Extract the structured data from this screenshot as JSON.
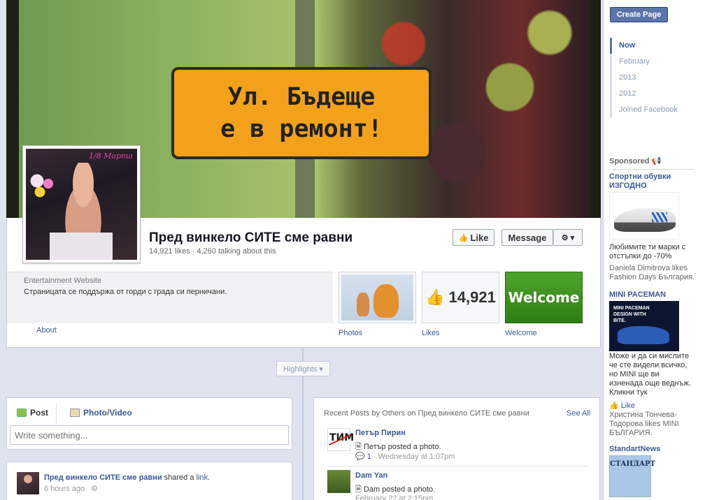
{
  "cover": {
    "sign_line1": "Ул. Бъдеще",
    "sign_line2": "е в ремонт!"
  },
  "profile": {
    "signature": "1/8 Марта"
  },
  "page": {
    "name": "Пред винкело СИТЕ сме равни",
    "stats": "14,921 likes · 4,260 talking about this",
    "category": "Entertainment Website",
    "description": "Страницата се поддържа от горди с града си перничани.",
    "about_label": "About"
  },
  "actions": {
    "like_label": "Like",
    "message_label": "Message",
    "gear_label": "⚙ ▾"
  },
  "apps": {
    "photos_label": "Photos",
    "likes_label": "Likes",
    "likes_count": "14,921",
    "welcome_label": "Welcome",
    "welcome_tile": "Welcome"
  },
  "timeline": {
    "highlights_label": "Highlights ▾"
  },
  "composer": {
    "post_tab": "Post",
    "photo_tab": "Photo",
    "photo_sep": " / ",
    "video_tab": "Video",
    "placeholder": "Write something..."
  },
  "story": {
    "author": "Пред винкело СИТЕ сме равни",
    "verb": " shared a ",
    "object": "link",
    "period": ".",
    "time": "6 hours ago",
    "time_icon": "⚙"
  },
  "recent_posts": {
    "title": "Recent Posts by Others on Пред винкело СИТЕ сме равни",
    "see_all": "See All",
    "items": [
      {
        "avatar_text": "ТИМ",
        "name": "Петър Пирин",
        "action": "Петър posted a photo.",
        "comments": "1",
        "time": "Wednesday at 1:07pm"
      },
      {
        "name": "Dam Yan",
        "action": "Dam posted a photo.",
        "time": "February 22 at 2:15pm"
      }
    ]
  },
  "sidebar": {
    "create_page": "Create Page",
    "years": [
      "Now",
      "February",
      "2013",
      "2012",
      "Joined Facebook"
    ],
    "active_year": "Now"
  },
  "ads": {
    "heading": "Sponsored",
    "items": [
      {
        "title": "Спортни обувки ИЗГОДНО",
        "text": "Любимите ти марки с отстъпки до -70%",
        "social": "Daniela Dimitrova likes Fashion Days България."
      },
      {
        "title": "MINI PACEMAN",
        "image_text": "MINI PACEMAN DESIGN WITH BITE.",
        "text": "Може и да си мислите че сте видели всичко, но MINI ще ви изненада още веднъж. Кликни тук",
        "like_label": "Like",
        "social": "Христина Тончева-Тодорова likes MINI БЪЛГАРИЯ."
      },
      {
        "title": "StandartNews",
        "image_text": "СТАНДАРТ"
      }
    ]
  },
  "colors": {
    "fb_blue": "#3b5998",
    "welcome_green": "#3a8c1c",
    "sign_orange": "#f3a11b"
  }
}
